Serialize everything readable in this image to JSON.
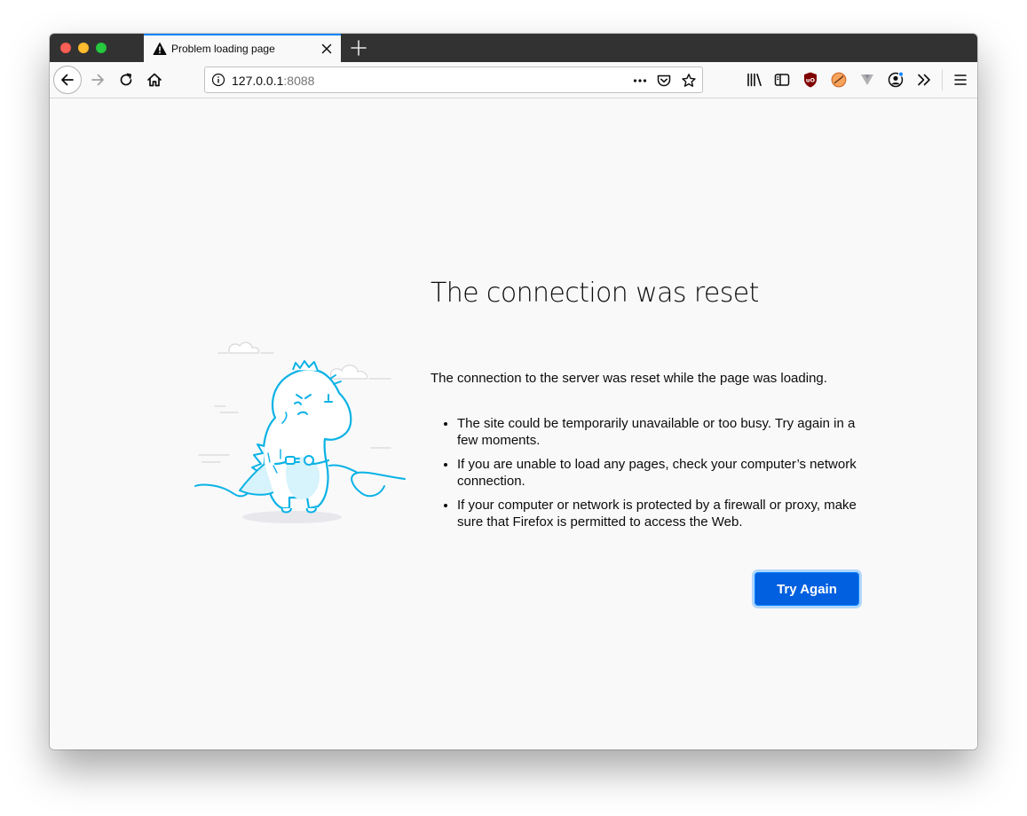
{
  "tab": {
    "title": "Problem loading page",
    "icon": "warning-icon"
  },
  "urlbar": {
    "host": "127.0.0.1",
    "port": ":8088"
  },
  "error_page": {
    "title": "The connection was reset",
    "description": "The connection to the server was reset while the page was loading.",
    "suggestions": [
      "The site could be temporarily unavailable or too busy. Try again in a few moments.",
      "If you are unable to load any pages, check your computer’s network connection.",
      "If your computer or network is protected by a firewall or proxy, make sure that Firefox is permitted to access the Web."
    ],
    "try_again_label": "Try Again"
  },
  "colors": {
    "accent": "#0a84ff",
    "button": "#0060df",
    "illustration": "#0ab2e5"
  }
}
